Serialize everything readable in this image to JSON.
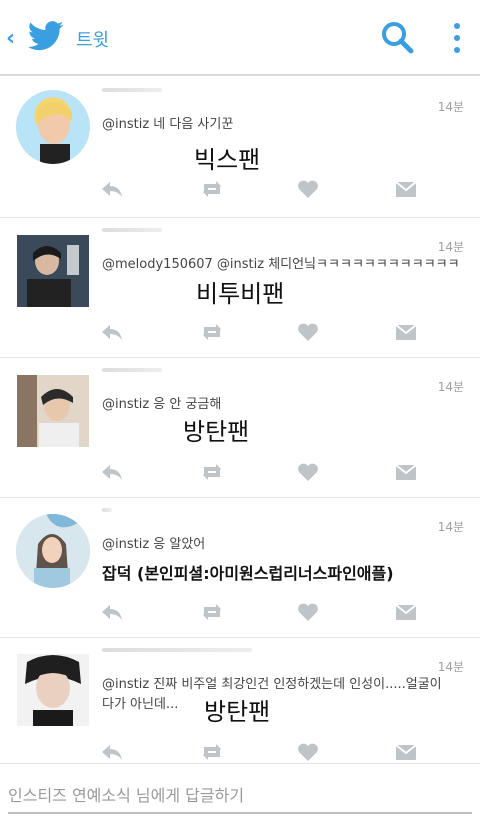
{
  "header": {
    "title": "트윗",
    "accent": "#3a9fe0"
  },
  "tweets": [
    {
      "time": "14분",
      "text": "@instiz 네 다음 사기꾼",
      "overlay": "빅스팬"
    },
    {
      "time": "14분",
      "text": "@melody150607 @instiz 체디언닠ㅋㅋㅋㅋㅋㅋㅋㅋㅋㅋㅋㅋ",
      "overlay": "비투비팬"
    },
    {
      "time": "14분",
      "text": "@instiz 응 안 궁금해",
      "overlay": "방탄팬"
    },
    {
      "time": "14분",
      "text": "@instiz 응 알았어",
      "overlay": "잡덕 (본인피셜:아미원스럽리너스파인애플)"
    },
    {
      "time": "14분",
      "text": "@instiz 진짜 비주얼 최강인건 인정하겠는데 인성이.....얼굴이다가 아닌데...",
      "overlay": "방탄팬"
    }
  ],
  "reply": {
    "placeholder": "인스티즈 연예소식 님에게 답글하기"
  }
}
